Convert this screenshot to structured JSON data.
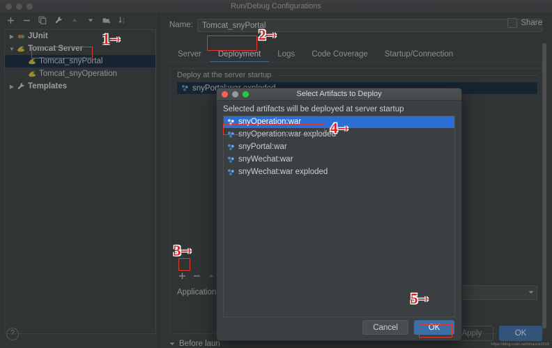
{
  "window": {
    "title": "Run/Debug Configurations"
  },
  "left_panel": {
    "toolbar": [
      {
        "name": "add-icon",
        "glyph": "+"
      },
      {
        "name": "remove-icon",
        "glyph": "−"
      },
      {
        "name": "copy-icon",
        "glyph": "❐"
      },
      {
        "name": "wrench-icon",
        "glyph": "ὒ7"
      },
      {
        "name": "move-up-icon",
        "glyph": "▲"
      },
      {
        "name": "move-down-icon",
        "glyph": "▼"
      },
      {
        "name": "new-folder-icon",
        "glyph": "▰"
      },
      {
        "name": "sort-icon",
        "glyph": "↓"
      }
    ],
    "tree": [
      {
        "label": "JUnit",
        "arrow": "▶",
        "bold": true,
        "indent": false,
        "selected": false,
        "icon": "junit-icon"
      },
      {
        "label": "Tomcat Server",
        "arrow": "▼",
        "bold": true,
        "indent": false,
        "selected": false,
        "icon": "tomcat-icon"
      },
      {
        "label": "Tomcat_snyPortal",
        "arrow": "",
        "bold": false,
        "indent": true,
        "selected": true,
        "icon": "tomcat-icon"
      },
      {
        "label": "Tomcat_snyOperation",
        "arrow": "",
        "bold": false,
        "indent": true,
        "selected": false,
        "icon": "tomcat-icon"
      },
      {
        "label": "Templates",
        "arrow": "▶",
        "bold": true,
        "indent": false,
        "selected": false,
        "icon": "wrench-icon"
      }
    ],
    "help_glyph": "?"
  },
  "right_panel": {
    "name_label": "Name:",
    "name_value": "Tomcat_snyPortal",
    "share_label": "Share",
    "tabs": [
      {
        "label": "Server",
        "active": false
      },
      {
        "label": "Deployment",
        "active": true
      },
      {
        "label": "Logs",
        "active": false
      },
      {
        "label": "Code Coverage",
        "active": false
      },
      {
        "label": "Startup/Connection",
        "active": false
      }
    ],
    "group_label": "Deploy at the server startup",
    "deploy_rows": [
      {
        "label": "snyPortal:war exploded",
        "icon": "artifact-icon",
        "selected": true
      }
    ],
    "list_toolbar": [
      {
        "name": "add-artifact-icon",
        "glyph": "+"
      },
      {
        "name": "remove-artifact-icon",
        "glyph": "−"
      },
      {
        "name": "move-up-artifact-icon",
        "glyph": "▲"
      }
    ],
    "application_label": "Application",
    "application_value": "",
    "before_launch_label": "Before laun",
    "before_launch_arrow": "▼",
    "buttons": {
      "apply": "Apply",
      "ok": "OK"
    }
  },
  "dialog": {
    "title": "Select Artifacts to Deploy",
    "hint": "Selected artifacts will be deployed at server startup",
    "items": [
      {
        "label": "snyOperation:war",
        "icon": "artifact-icon",
        "selected": true
      },
      {
        "label": "snyOperation:war exploded",
        "icon": "artifact-icon",
        "selected": false
      },
      {
        "label": "snyPortal:war",
        "icon": "artifact-icon",
        "selected": false
      },
      {
        "label": "snyWechat:war",
        "icon": "artifact-icon",
        "selected": false
      },
      {
        "label": "snyWechat:war exploded",
        "icon": "artifact-icon",
        "selected": false
      }
    ],
    "buttons": {
      "cancel": "Cancel",
      "ok": "OK"
    }
  },
  "annotations": {
    "markers": [
      {
        "id": "1",
        "text": "1"
      },
      {
        "id": "2",
        "text": "2"
      },
      {
        "id": "3",
        "text": "3"
      },
      {
        "id": "4",
        "text": "4"
      },
      {
        "id": "5",
        "text": "5"
      }
    ],
    "marker_tail": "˘"
  },
  "watermark": "https://blog.csdn.net/shaock2018"
}
